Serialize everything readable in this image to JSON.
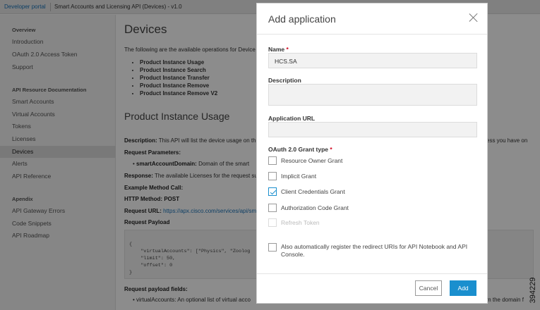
{
  "topbar": {
    "portal": "Developer portal",
    "breadcrumb": "Smart Accounts and Licensing API (Devices) - v1.0"
  },
  "sidebar": {
    "overview_head": "Overview",
    "overview_items": [
      "Introduction",
      "OAuth 2.0 Access Token",
      "Support"
    ],
    "api_head": "API Resource Documentation",
    "api_items": [
      "Smart Accounts",
      "Virtual Accounts",
      "Tokens",
      "Licenses",
      "Devices",
      "Alerts",
      "API Reference"
    ],
    "apendix_head": "Apendix",
    "apendix_items": [
      "API Gateway Errors",
      "Code Snippets",
      "API Roadmap"
    ],
    "active": "Devices"
  },
  "main": {
    "title": "Devices",
    "intro": "The following are the available operations for Device",
    "operations": [
      "Product Instance Usage",
      "Product Instance Search",
      "Product Instance Transfer",
      "Product Instance Remove",
      "Product Instance Remove V2"
    ],
    "section_title": "Product Instance Usage",
    "description_label": "Description:",
    "description_text": "This API will list the device usage on the",
    "description_tail": "ess you have on",
    "request_params_label": "Request Parameters:",
    "param_name": "smartAccountDomain:",
    "param_text": "Domain of the smart",
    "response_label": "Response:",
    "response_text": "The available Licenses for the request su",
    "example_label": "Example Method Call:",
    "http_method_label": "HTTP Method:",
    "http_method_value": "POST",
    "request_url_label": "Request URL:",
    "request_url_value": "https://apx.cisco.com/services/api/sm",
    "request_payload_label": "Request Payload",
    "code_lines": [
      "{",
      "    \"virtualAccounts\": [\"Physics\", \"Zoolog",
      "    \"limit\": 50,",
      "    \"offset\": 0",
      "}"
    ],
    "payload_fields_label": "Request payload fields:",
    "payload_field_text": "virtualAccounts: An optional list of virtual acco",
    "payload_field_tail": "m the domain f"
  },
  "modal": {
    "title": "Add application",
    "name_label": "Name",
    "name_value": "HCS.SA",
    "required_mark": "*",
    "description_label": "Description",
    "description_value": "",
    "url_label": "Application URL",
    "url_value": "",
    "grant_label": "OAuth 2.0 Grant type",
    "grants": [
      {
        "label": "Resource Owner Grant",
        "checked": false,
        "disabled": false
      },
      {
        "label": "Implicit Grant",
        "checked": false,
        "disabled": false
      },
      {
        "label": "Client Credentials Grant",
        "checked": true,
        "disabled": false
      },
      {
        "label": "Authorization Code Grant",
        "checked": false,
        "disabled": false
      },
      {
        "label": "Refresh Token",
        "checked": false,
        "disabled": true
      }
    ],
    "auto_register_text": "Also automatically register the redirect URIs for API Notebook and API Console.",
    "auto_register_checked": false,
    "cancel_label": "Cancel",
    "add_label": "Add"
  },
  "figure_id": "394229",
  "colors": {
    "accent": "#1a8fce",
    "link": "#1a73b8",
    "required": "#d0021b"
  }
}
